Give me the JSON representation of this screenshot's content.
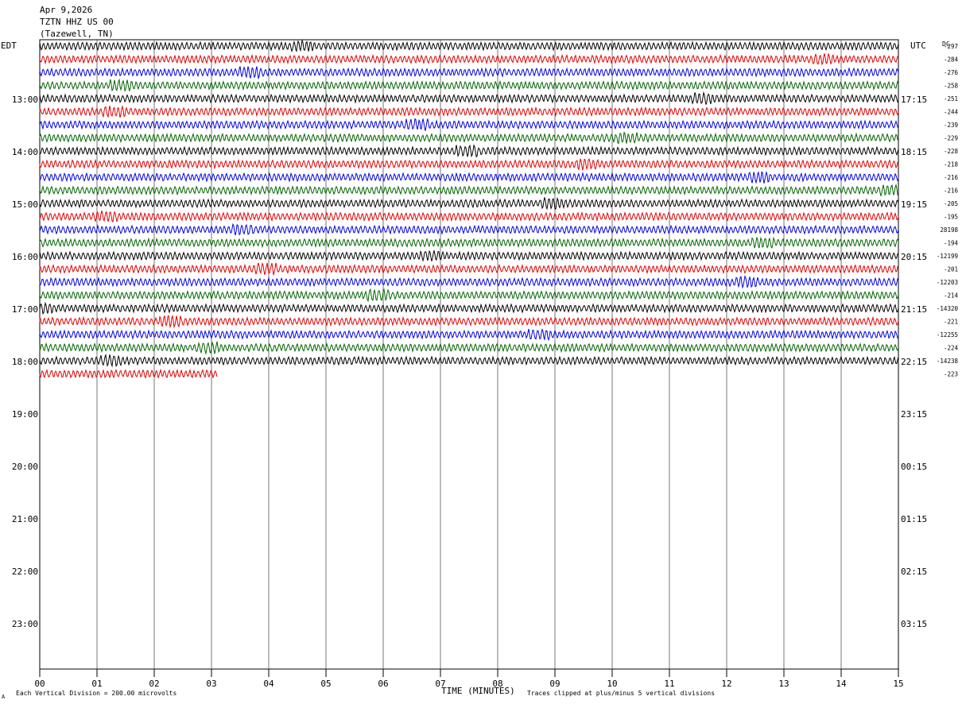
{
  "header": {
    "date": "Apr 9,2026",
    "station": "TZTN HHZ US 00",
    "location": "(Tazewell, TN)"
  },
  "left_zone_label": "EDT",
  "right_zone_label": "UTC",
  "dc_label": "DC",
  "footer": {
    "scale_note": "Each Vertical Division =  200.00 microvolts",
    "xlabel": "TIME (MINUTES)",
    "clip_note": "Traces clipped at plus/minus 5 vertical divisions",
    "corner_mark": "A"
  },
  "chart_data": {
    "type": "line",
    "title": "Apr 9,2026 TZTN HHZ US 00 (Tazewell, TN)",
    "xlabel": "TIME (MINUTES)",
    "xlim": [
      0,
      15
    ],
    "x_ticks": [
      "00",
      "01",
      "02",
      "03",
      "04",
      "05",
      "06",
      "07",
      "08",
      "09",
      "10",
      "11",
      "12",
      "13",
      "14",
      "15"
    ],
    "row_minutes": 15,
    "hour_labels_local": [
      "13:00",
      "14:00",
      "15:00",
      "16:00",
      "17:00",
      "18:00",
      "19:00",
      "20:00",
      "21:00",
      "22:00",
      "23:00"
    ],
    "hour_labels_utc": [
      "17:15",
      "18:15",
      "19:15",
      "20:15",
      "21:15",
      "22:15",
      "23:15",
      "00:15",
      "01:15",
      "02:15",
      "03:15"
    ],
    "trace_colors": [
      "#000000",
      "#e00000",
      "#0000e0",
      "#006400"
    ],
    "dc_offsets": [
      "-297",
      "-284",
      "-276",
      "-258",
      "-251",
      "-244",
      "-239",
      "-229",
      "-228",
      "-218",
      "-216",
      "-216",
      "-205",
      "-195",
      "28198",
      "-194",
      "-12199",
      "-201",
      "-12203",
      "-214",
      "-14320",
      "-221",
      "-12255",
      "-224",
      "-14238",
      "-223"
    ],
    "trace_count": 26,
    "last_trace_minutes": 3.1
  }
}
